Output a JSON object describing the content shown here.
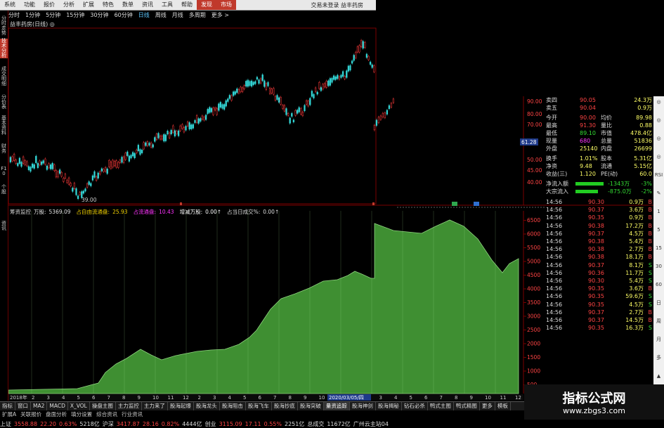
{
  "menubar": {
    "items": [
      "系统",
      "功能",
      "报价",
      "分析",
      "扩展",
      "特色",
      "数单",
      "资讯",
      "工具",
      "帮助"
    ],
    "highlight": [
      "发现",
      "市场"
    ],
    "status": "交易未登录",
    "stock": "益丰药房"
  },
  "periods": {
    "items": [
      "分时",
      "1分钟",
      "5分钟",
      "15分钟",
      "30分钟",
      "60分钟",
      "日线",
      "周线",
      "月线",
      "多周期",
      "更多 >"
    ],
    "active": "日线"
  },
  "stock_title": "益丰药房(日线) ◎",
  "left_tabs": [
    "分时走势",
    "技术分析",
    "成交明细",
    "分价表",
    "基本资料",
    "财务",
    "F10",
    "个股",
    "资讯"
  ],
  "price_chart": {
    "y_ticks": [
      "90.00",
      "80.00",
      "70.00",
      "61.28",
      "50.00",
      "45.00",
      "40.00"
    ],
    "low_label": "39.00",
    "current_price_label": "61.28"
  },
  "volume_chart": {
    "y_ticks": [
      "6500",
      "6000",
      "5500",
      "5000",
      "4500",
      "4000",
      "3500",
      "3000",
      "2500",
      "2000",
      "1500",
      "1000",
      "500"
    ],
    "date_label": "2020/03/05/四",
    "year_label": "2018年"
  },
  "indicator": {
    "name": "筹资监控",
    "items": [
      {
        "label": "万股:",
        "value": "5369.09",
        "color": "#e0e0e0"
      },
      {
        "label": "占自由流通盘:",
        "value": "25.93",
        "color": "#f0d000"
      },
      {
        "label": "占流通盘:",
        "value": "10.43",
        "color": "#ff33ff"
      },
      {
        "label": "增减万股:",
        "value": "0.00↑",
        "color": "#ffffff"
      },
      {
        "label": "占当日成交%:",
        "value": "0.00↑",
        "color": "#dddddd"
      }
    ]
  },
  "quote": {
    "rows": [
      {
        "label": "卖四",
        "v1": "90.05",
        "v2": "24.3万"
      },
      {
        "label": "卖五",
        "v1": "90.04",
        "v2": "0.9万"
      },
      {
        "label": "今开",
        "v1": "90.00",
        "l2": "均价",
        "v2": "89.98"
      },
      {
        "label": "最高",
        "v1": "91.30",
        "l2": "量比",
        "v2": "0.88"
      },
      {
        "label": "最低",
        "v1": "89.10",
        "l2": "市值",
        "v2": "478.4亿"
      },
      {
        "label": "现量",
        "v1": "680",
        "l2": "总量",
        "v2": "51836"
      },
      {
        "label": "外盘",
        "v1": "25140",
        "l2": "内盘",
        "v2": "26699"
      },
      {
        "label": "换手",
        "v1": "1.01%",
        "l2": "股本",
        "v2": "5.31亿"
      },
      {
        "label": "净资",
        "v1": "9.48",
        "l2": "流通",
        "v2": "5.15亿"
      },
      {
        "label": "收益(三)",
        "v1": "1.120",
        "l2": "PE(动)",
        "v2": "60.0"
      }
    ],
    "flow": [
      {
        "label": "净流入额",
        "value": "-1343万",
        "pct": "-3%"
      },
      {
        "label": "大宗流入",
        "value": "-875.0万",
        "pct": "-2%"
      }
    ],
    "ticks": [
      {
        "t": "14:56",
        "p": "90.30",
        "v": "0.9万",
        "d": "B"
      },
      {
        "t": "14:56",
        "p": "90.37",
        "v": "3.6万",
        "d": "B"
      },
      {
        "t": "14:56",
        "p": "90.35",
        "v": "0.9万",
        "d": "B"
      },
      {
        "t": "14:56",
        "p": "90.38",
        "v": "17.2万",
        "d": "B"
      },
      {
        "t": "14:56",
        "p": "90.37",
        "v": "4.5万",
        "d": "B"
      },
      {
        "t": "14:56",
        "p": "90.38",
        "v": "5.4万",
        "d": "B"
      },
      {
        "t": "14:56",
        "p": "90.38",
        "v": "2.7万",
        "d": "B"
      },
      {
        "t": "14:56",
        "p": "90.38",
        "v": "18.1万",
        "d": "B"
      },
      {
        "t": "14:56",
        "p": "90.37",
        "v": "8.1万",
        "d": "S"
      },
      {
        "t": "14:56",
        "p": "90.36",
        "v": "11.7万",
        "d": "S"
      },
      {
        "t": "14:56",
        "p": "90.30",
        "v": "5.4万",
        "d": "S"
      },
      {
        "t": "14:56",
        "p": "90.35",
        "v": "3.6万",
        "d": "B"
      },
      {
        "t": "14:56",
        "p": "90.35",
        "v": "59.6万",
        "d": "S"
      },
      {
        "t": "14:56",
        "p": "90.35",
        "v": "4.5万",
        "d": "S"
      },
      {
        "t": "14:56",
        "p": "90.37",
        "v": "2.7万",
        "d": "B"
      },
      {
        "t": "14:56",
        "p": "90.37",
        "v": "14.5万",
        "d": "B"
      },
      {
        "t": "14:56",
        "p": "90.35",
        "v": "16.3万",
        "d": "S"
      }
    ]
  },
  "right_strip": [
    "◎",
    "◎",
    "◎",
    "◎",
    "RSI",
    "✎",
    "1",
    "5",
    "15",
    "30",
    "60",
    "日",
    "周",
    "月",
    "多",
    "▲"
  ],
  "bottom_tabs": [
    "指标",
    "窗口",
    "MA2",
    "MACD",
    "X_VOL",
    "操盘主图",
    "主力监控",
    "主力来了",
    "股海起爆",
    "股海龙头",
    "股海阻击",
    "股海飞车",
    "股海抄底",
    "股海突破",
    "量资追踪",
    "股海神剑",
    "股海揭秘",
    "钻石必杀",
    "鸭式主图",
    "鸭式精图",
    "更多",
    "模板"
  ],
  "bottom_tabs_active": "量资追踪",
  "bottom_row2": [
    "扩展A",
    "关联报价",
    "盘面分析",
    "填分设置",
    "综合资讯",
    "行业资讯"
  ],
  "status_bar": [
    {
      "text": "上证",
      "color": "#ddd"
    },
    {
      "text": "3558.88",
      "color": "#ff4444"
    },
    {
      "text": "22.20",
      "color": "#ff4444"
    },
    {
      "text": "0.63%",
      "color": "#ff4444"
    },
    {
      "text": "5218亿",
      "color": "#dddddd"
    },
    {
      "text": "沪深",
      "color": "#dddddd"
    },
    {
      "text": "3417.87",
      "color": "#ff4444"
    },
    {
      "text": "28.16",
      "color": "#ff4444"
    },
    {
      "text": "0.82%",
      "color": "#ff4444"
    },
    {
      "text": "4444亿",
      "color": "#dddddd"
    },
    {
      "text": "创业",
      "color": "#dddddd"
    },
    {
      "text": "3115.09",
      "color": "#ff4444"
    },
    {
      "text": "17.11",
      "color": "#ff4444"
    },
    {
      "text": "0.55%",
      "color": "#ff4444"
    },
    {
      "text": "2251亿",
      "color": "#dddddd"
    },
    {
      "text": "总成交",
      "color": "#dddddd"
    },
    {
      "text": "11672亿",
      "color": "#dddddd"
    },
    {
      "text": "广州云主站04",
      "color": "#dddddd"
    }
  ],
  "watermark": {
    "title": "指标公式网",
    "url": "www.zbgs3.com"
  },
  "colors": {
    "up": "#ff3b3b",
    "down": "#33d6d6",
    "volume_fill": "#3f8f32",
    "grid": "#7a0000"
  }
}
